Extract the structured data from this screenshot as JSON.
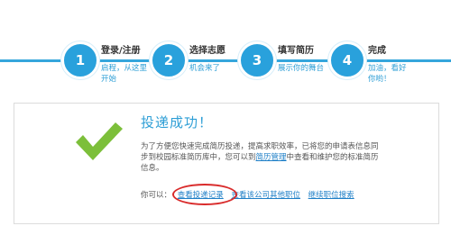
{
  "steps": [
    {
      "number": "1",
      "title": "登录/注册",
      "desc": "启程，从这里开始"
    },
    {
      "number": "2",
      "title": "选择志愿",
      "desc": "机会来了"
    },
    {
      "number": "3",
      "title": "填写简历",
      "desc": "展示你的舞台"
    },
    {
      "number": "4",
      "title": "完成",
      "desc": "加油，看好你哟！"
    }
  ],
  "result": {
    "title": "投递成功！",
    "message_pre": "为了方便您快速完成简历投递，提高求职效率，已将您的申请表信息同步到校园标准简历库中，您可以到",
    "message_link": "简历管理",
    "message_post": "中查看和维护您的标准简历信息。",
    "actions_label": "你可以：",
    "actions": [
      "查看投递记录",
      "查看该公司其他职位",
      "继续职位搜索"
    ]
  },
  "colors": {
    "accent": "#2f9fd6",
    "check": "#7cbf3a",
    "highlight_circle": "#d92b2b"
  },
  "icons": {
    "success": "check-icon"
  }
}
